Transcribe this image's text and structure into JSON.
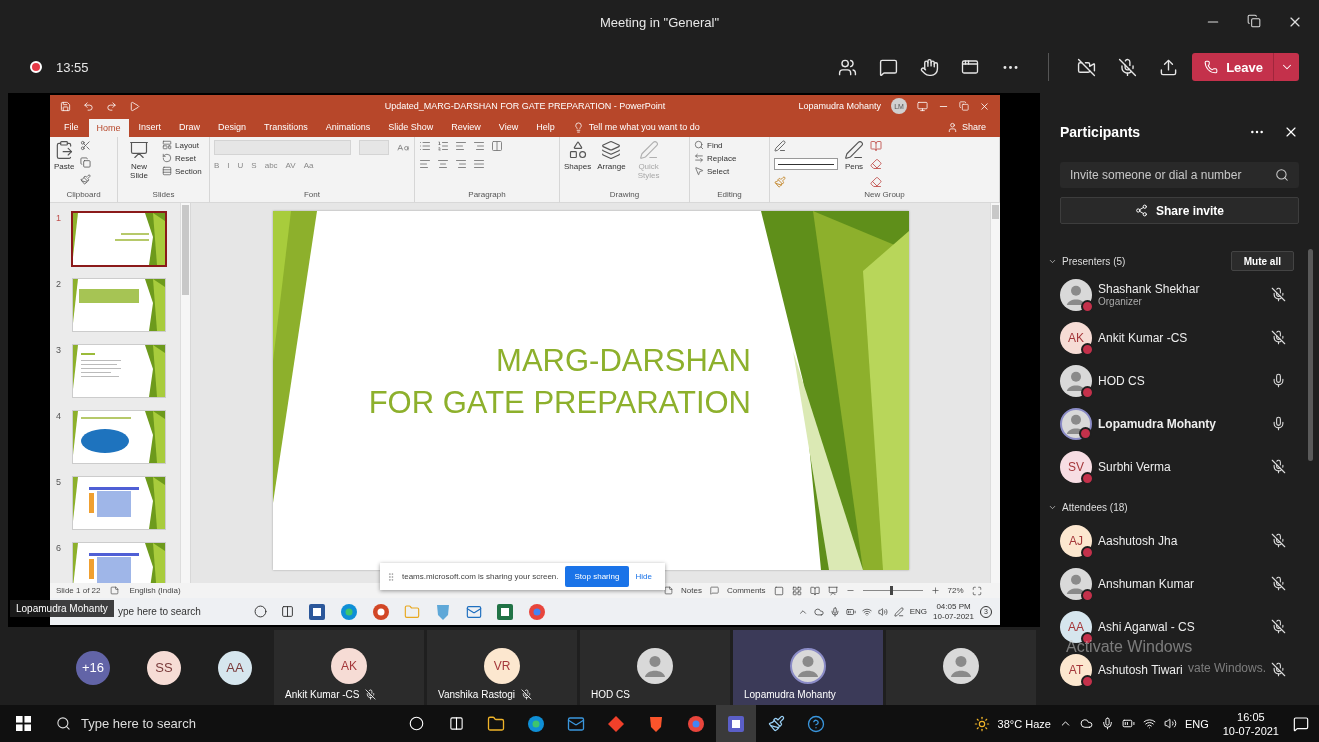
{
  "window": {
    "title": "Meeting in \"General\""
  },
  "meeting_bar": {
    "recording": true,
    "duration": "13:55",
    "camera_on": false,
    "mic_muted": true,
    "leave_label": "Leave"
  },
  "shared_screen": {
    "presenter_label": "Lopamudra Mohanty",
    "powerpoint": {
      "title": "Updated_MARG-DARSHAN FOR GATE PREPARATION  -  PowerPoint",
      "user_name": "Lopamudra Mohanty",
      "user_initials": "LM",
      "tabs": [
        {
          "label": "File",
          "selected": false
        },
        {
          "label": "Home",
          "selected": true
        },
        {
          "label": "Insert",
          "selected": false
        },
        {
          "label": "Draw",
          "selected": false
        },
        {
          "label": "Design",
          "selected": false
        },
        {
          "label": "Transitions",
          "selected": false
        },
        {
          "label": "Animations",
          "selected": false
        },
        {
          "label": "Slide Show",
          "selected": false
        },
        {
          "label": "Review",
          "selected": false
        },
        {
          "label": "View",
          "selected": false
        },
        {
          "label": "Help",
          "selected": false
        }
      ],
      "tell_me": "Tell me what you want to do",
      "share": "Share",
      "ribbon_groups": [
        {
          "kind": "clipboard",
          "label": "Clipboard",
          "buttons": [
            {
              "label": "Paste",
              "disabled": false
            }
          ]
        },
        {
          "kind": "slides",
          "label": "Slides",
          "buttons": [
            {
              "label": "New Slide",
              "disabled": false
            }
          ],
          "small_buttons": [
            {
              "label": "Layout",
              "disabled": false
            },
            {
              "label": "Reset",
              "disabled": false
            },
            {
              "label": "Section",
              "disabled": false
            }
          ]
        },
        {
          "kind": "font",
          "label": "Font",
          "format_buttons": [
            "B",
            "I",
            "U",
            "S",
            "abc",
            "AV",
            "Aa"
          ]
        },
        {
          "kind": "paragraph",
          "label": "Paragraph"
        },
        {
          "kind": "drawing",
          "label": "Drawing",
          "buttons": [
            {
              "label": "Shapes",
              "disabled": false
            },
            {
              "label": "Arrange",
              "disabled": false
            },
            {
              "label": "Quick Styles",
              "disabled": true
            }
          ]
        },
        {
          "kind": "editing",
          "label": "Editing",
          "small_buttons": [
            {
              "label": "Find",
              "disabled": false
            },
            {
              "label": "Replace",
              "disabled": false
            },
            {
              "label": "Select",
              "disabled": false
            }
          ]
        },
        {
          "kind": "pens",
          "label": "New Group",
          "buttons": [
            {
              "label": "Pens",
              "disabled": false
            }
          ]
        }
      ],
      "thumbnails": [
        {
          "number": "1",
          "kind": "title",
          "selected": true
        },
        {
          "number": "2",
          "kind": "banner",
          "selected": false
        },
        {
          "number": "3",
          "kind": "list",
          "selected": false
        },
        {
          "number": "4",
          "kind": "diagram",
          "selected": false
        },
        {
          "number": "5",
          "kind": "table",
          "selected": false
        },
        {
          "number": "6",
          "kind": "table",
          "selected": false
        }
      ],
      "slide": {
        "title_lines": [
          "MARG-DARSHAN",
          "FOR GATE PREPARATION"
        ]
      },
      "status_bar": {
        "slide_info": "Slide 1 of 22",
        "language": "English (India)",
        "notes": "Notes",
        "comments": "Comments",
        "zoom": "72%",
        "level": 0.45
      }
    },
    "share_notice": {
      "text": "teams.microsoft.com is sharing your screen.",
      "stop_label": "Stop sharing",
      "hide_label": "Hide"
    },
    "taskbar": {
      "search": "ype here to search",
      "language": "ENG",
      "time": "04:05 PM",
      "date": "10-07-2021",
      "notifications": "3"
    }
  },
  "video_strip": {
    "overflow_count": "+16",
    "avatars": [
      {
        "initials": "SS",
        "color": "#f6dcd5"
      },
      {
        "initials": "AA",
        "color": "#d6e6ee"
      }
    ],
    "tiles": [
      {
        "kind": "initials",
        "initials": "AK",
        "color": "#f6dcd5",
        "name": "Ankit Kumar -CS",
        "muted": true,
        "speaking": false
      },
      {
        "kind": "initials",
        "initials": "VR",
        "color": "#fce7cf",
        "name": "Vanshika Rastogi",
        "muted": true,
        "speaking": false
      },
      {
        "kind": "photo",
        "name": "HOD CS",
        "muted": false,
        "speaking": false
      },
      {
        "kind": "photo",
        "name": "Lopamudra Mohanty",
        "muted": false,
        "speaking": true
      },
      {
        "kind": "photo",
        "muted": false,
        "speaking": false
      }
    ]
  },
  "participants": {
    "title": "Participants",
    "search_placeholder": "Invite someone or dial a number",
    "share_invite": "Share invite",
    "groups": [
      {
        "label": "Presenters (5)",
        "expanded": true,
        "action": "Mute all",
        "people": [
          {
            "kind": "photo",
            "name": "Shashank Shekhar",
            "role": "Organizer",
            "muted": true,
            "speaking": false
          },
          {
            "kind": "initials",
            "initials": "AK",
            "color": "#f6dcd5",
            "name": "Ankit Kumar -CS",
            "muted": true,
            "speaking": false
          },
          {
            "kind": "photo",
            "name": "HOD CS",
            "muted": false,
            "speaking": false
          },
          {
            "kind": "photo",
            "name": "Lopamudra Mohanty",
            "muted": false,
            "speaking": true
          },
          {
            "kind": "initials",
            "initials": "SV",
            "color": "#f7dde3",
            "name": "Surbhi Verma",
            "muted": true,
            "speaking": false
          }
        ]
      },
      {
        "label": "Attendees (18)",
        "expanded": true,
        "people": [
          {
            "kind": "initials",
            "initials": "AJ",
            "color": "#fce7cf",
            "name": "Aashutosh Jha",
            "muted": true,
            "speaking": false
          },
          {
            "kind": "photo",
            "name": "Anshuman Kumar",
            "muted": true,
            "speaking": false
          },
          {
            "kind": "initials",
            "initials": "AA",
            "color": "#d6e6ee",
            "name": "Ashi Agarwal - CS",
            "muted": true,
            "speaking": false
          },
          {
            "kind": "initials",
            "initials": "AT",
            "color": "#fce7cf",
            "name": "Ashutosh Tiwari",
            "muted": true,
            "speaking": false
          }
        ]
      }
    ]
  },
  "system_notice": {
    "title": "Activate Windows",
    "text": "vate Windows."
  },
  "windows_taskbar": {
    "search": "Type here to search",
    "weather": "38°C Haze",
    "language": "ENG",
    "time": "16:05",
    "date": "10-07-2021"
  }
}
